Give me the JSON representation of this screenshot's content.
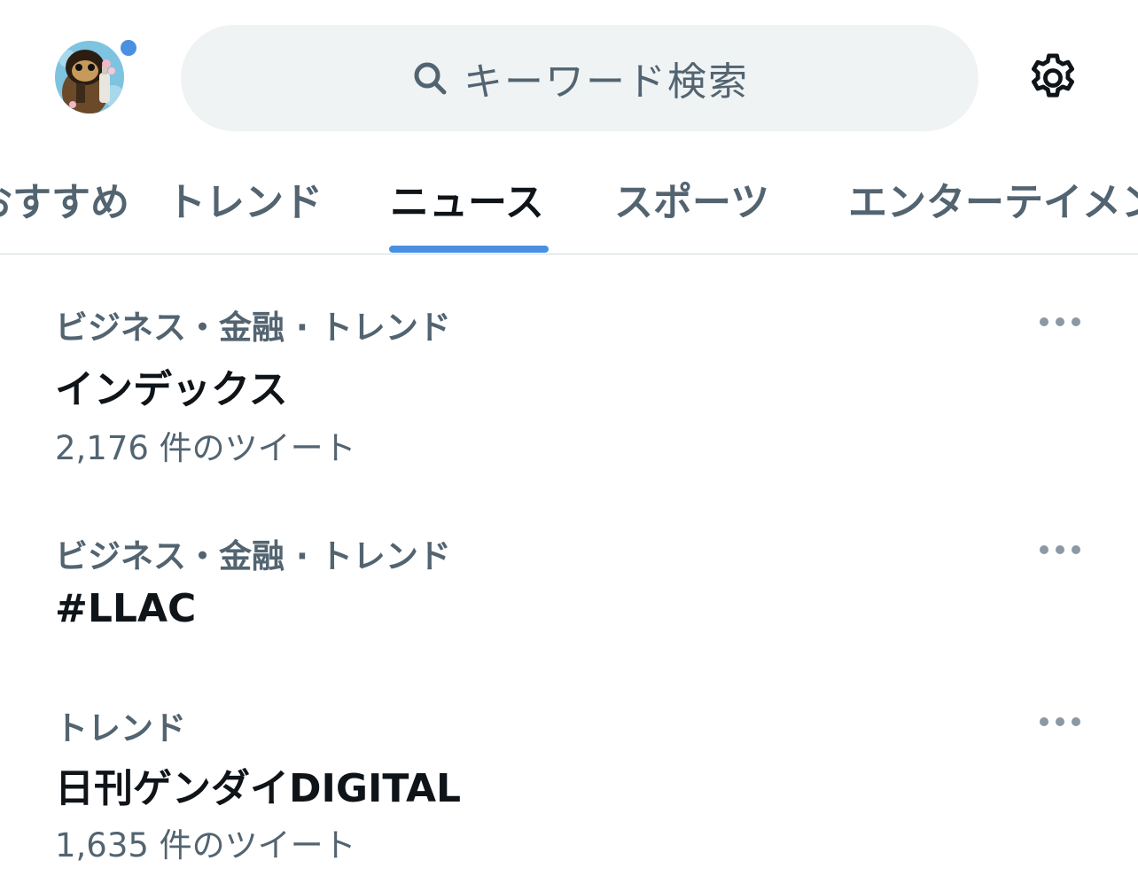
{
  "header": {
    "search_placeholder": "キーワード検索",
    "icons": {
      "avatar": "avatar",
      "search": "search-icon",
      "settings": "gear-icon",
      "notification_dot": "notification-dot"
    }
  },
  "tabs": [
    {
      "label": "おすすめ",
      "active": false
    },
    {
      "label": "トレンド",
      "active": false
    },
    {
      "label": "ニュース",
      "active": true
    },
    {
      "label": "スポーツ",
      "active": false
    },
    {
      "label": "エンターテイメント",
      "active": false
    }
  ],
  "trends": [
    {
      "category": "ビジネス・金融 · トレンド",
      "title": "インデックス",
      "count": "2,176 件のツイート"
    },
    {
      "category": "ビジネス・金融 · トレンド",
      "title": "#LLAC",
      "count": ""
    },
    {
      "category": "トレンド",
      "title": "日刊ゲンダイDIGITAL",
      "count": "1,635 件のツイート"
    }
  ],
  "colors": {
    "accent": "#4a90e2",
    "text_primary": "#0f1419",
    "text_secondary": "#536471",
    "search_bg": "#eff3f4",
    "divider": "#cfd9de"
  }
}
